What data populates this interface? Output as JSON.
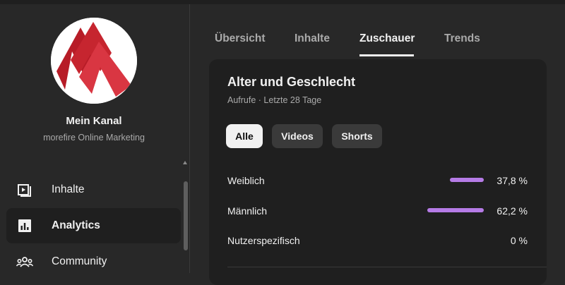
{
  "channel": {
    "name": "Mein Kanal",
    "subtitle": "morefire Online Marketing",
    "logo_colors": {
      "bg": "#ffffff",
      "red_dark": "#b71c27",
      "red_light": "#d93642"
    }
  },
  "sidebar": {
    "items": [
      {
        "label": "Inhalte",
        "icon": "video-library-icon",
        "active": false
      },
      {
        "label": "Analytics",
        "icon": "analytics-icon",
        "active": true
      },
      {
        "label": "Community",
        "icon": "community-icon",
        "active": false
      }
    ]
  },
  "tabs": [
    {
      "label": "Übersicht",
      "active": false
    },
    {
      "label": "Inhalte",
      "active": false
    },
    {
      "label": "Zuschauer",
      "active": true
    },
    {
      "label": "Trends",
      "active": false
    }
  ],
  "card": {
    "title": "Alter und Geschlecht",
    "subtitle": "Aufrufe · Letzte 28 Tage",
    "filters": [
      {
        "label": "Alle",
        "active": true
      },
      {
        "label": "Videos",
        "active": false
      },
      {
        "label": "Shorts",
        "active": false
      }
    ],
    "rows": [
      {
        "label": "Weiblich",
        "value": "37,8 %",
        "fraction": 0.378
      },
      {
        "label": "Männlich",
        "value": "62,2 %",
        "fraction": 0.622
      },
      {
        "label": "Nutzerspezifisch",
        "value": "0 %",
        "fraction": 0
      }
    ]
  },
  "colors": {
    "background": "#282828",
    "card": "#1f1f1f",
    "bar": "#b57be6",
    "text": "#f1f1f1",
    "muted": "#aaaaaa"
  }
}
